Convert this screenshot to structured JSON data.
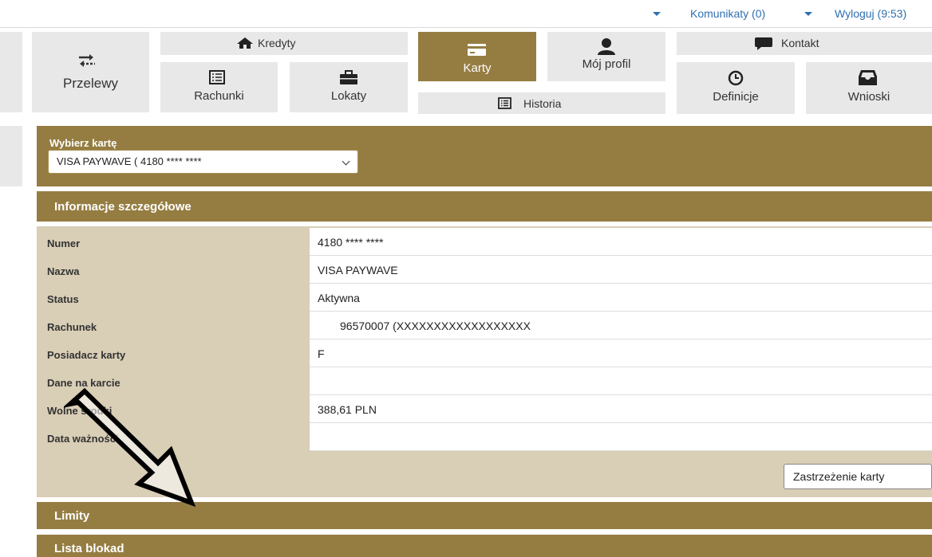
{
  "topbar": {
    "messages_label": "Komunikaty (0)",
    "logout_label": "Wyloguj (9:53)"
  },
  "nav": {
    "przelewy": "Przelewy",
    "kredyty": "Kredyty",
    "rachunki": "Rachunki",
    "lokaty": "Lokaty",
    "karty": "Karty",
    "historia": "Historia",
    "profil": "Mój profil",
    "kontakt": "Kontakt",
    "definicje": "Definicje",
    "wnioski": "Wnioski",
    "active": "Karty"
  },
  "card_select": {
    "label": "Wybierz kartę",
    "value": "VISA PAYWAVE ( 4180 **** ****"
  },
  "details": {
    "header": "Informacje szczegółowe",
    "rows": [
      {
        "label": "Numer",
        "value": "4180 **** ****"
      },
      {
        "label": "Nazwa",
        "value": "VISA PAYWAVE"
      },
      {
        "label": "Status",
        "value": "Aktywna"
      },
      {
        "label": "Rachunek",
        "value": "96570007 (XXXXXXXXXXXXXXXXXX"
      },
      {
        "label": "Posiadacz karty",
        "value": "F"
      },
      {
        "label": "Dane na karcie",
        "value": ""
      },
      {
        "label": "Wolne środki",
        "value": "388,61 PLN"
      },
      {
        "label": "Data ważności",
        "value": ""
      }
    ],
    "block_button": "Zastrzeżenie karty"
  },
  "sections": {
    "limits": "Limity",
    "blocks": "Lista blokad"
  },
  "colors": {
    "accent": "#957d42",
    "accent_light": "#d9ceb6",
    "link": "#2f6fb0",
    "tile": "#e8e8e8"
  }
}
